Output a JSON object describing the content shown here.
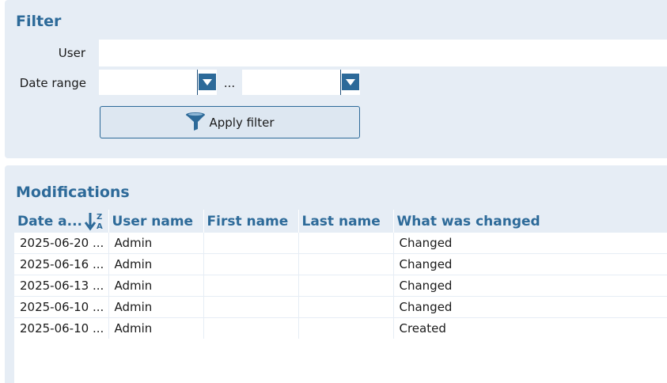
{
  "filter": {
    "title": "Filter",
    "user_label": "User",
    "user_value": "",
    "date_range_label": "Date range",
    "date_from_value": "",
    "date_to_value": "",
    "date_separator": "...",
    "apply_label": "Apply filter"
  },
  "modifications": {
    "title": "Modifications",
    "columns": [
      "Date a...",
      "User name",
      "First name",
      "Last name",
      "What was changed"
    ],
    "sort": {
      "column": "Date a...",
      "direction": "Z-A"
    },
    "rows": [
      [
        "2025-06-20 ...",
        "Admin",
        "",
        "",
        "Changed"
      ],
      [
        "2025-06-16 ...",
        "Admin",
        "",
        "",
        "Changed"
      ],
      [
        "2025-06-13 ...",
        "Admin",
        "",
        "",
        "Changed"
      ],
      [
        "2025-06-10 ...",
        "Admin",
        "",
        "",
        "Changed"
      ],
      [
        "2025-06-10 ...",
        "Admin",
        "",
        "",
        "Created"
      ]
    ]
  },
  "colors": {
    "panel_bg": "#e6edf5",
    "accent": "#2d6a99"
  },
  "icons": {
    "date_dropdown": "chevron-down-icon",
    "apply": "funnel-icon",
    "sort": "sort-descending-icon"
  }
}
